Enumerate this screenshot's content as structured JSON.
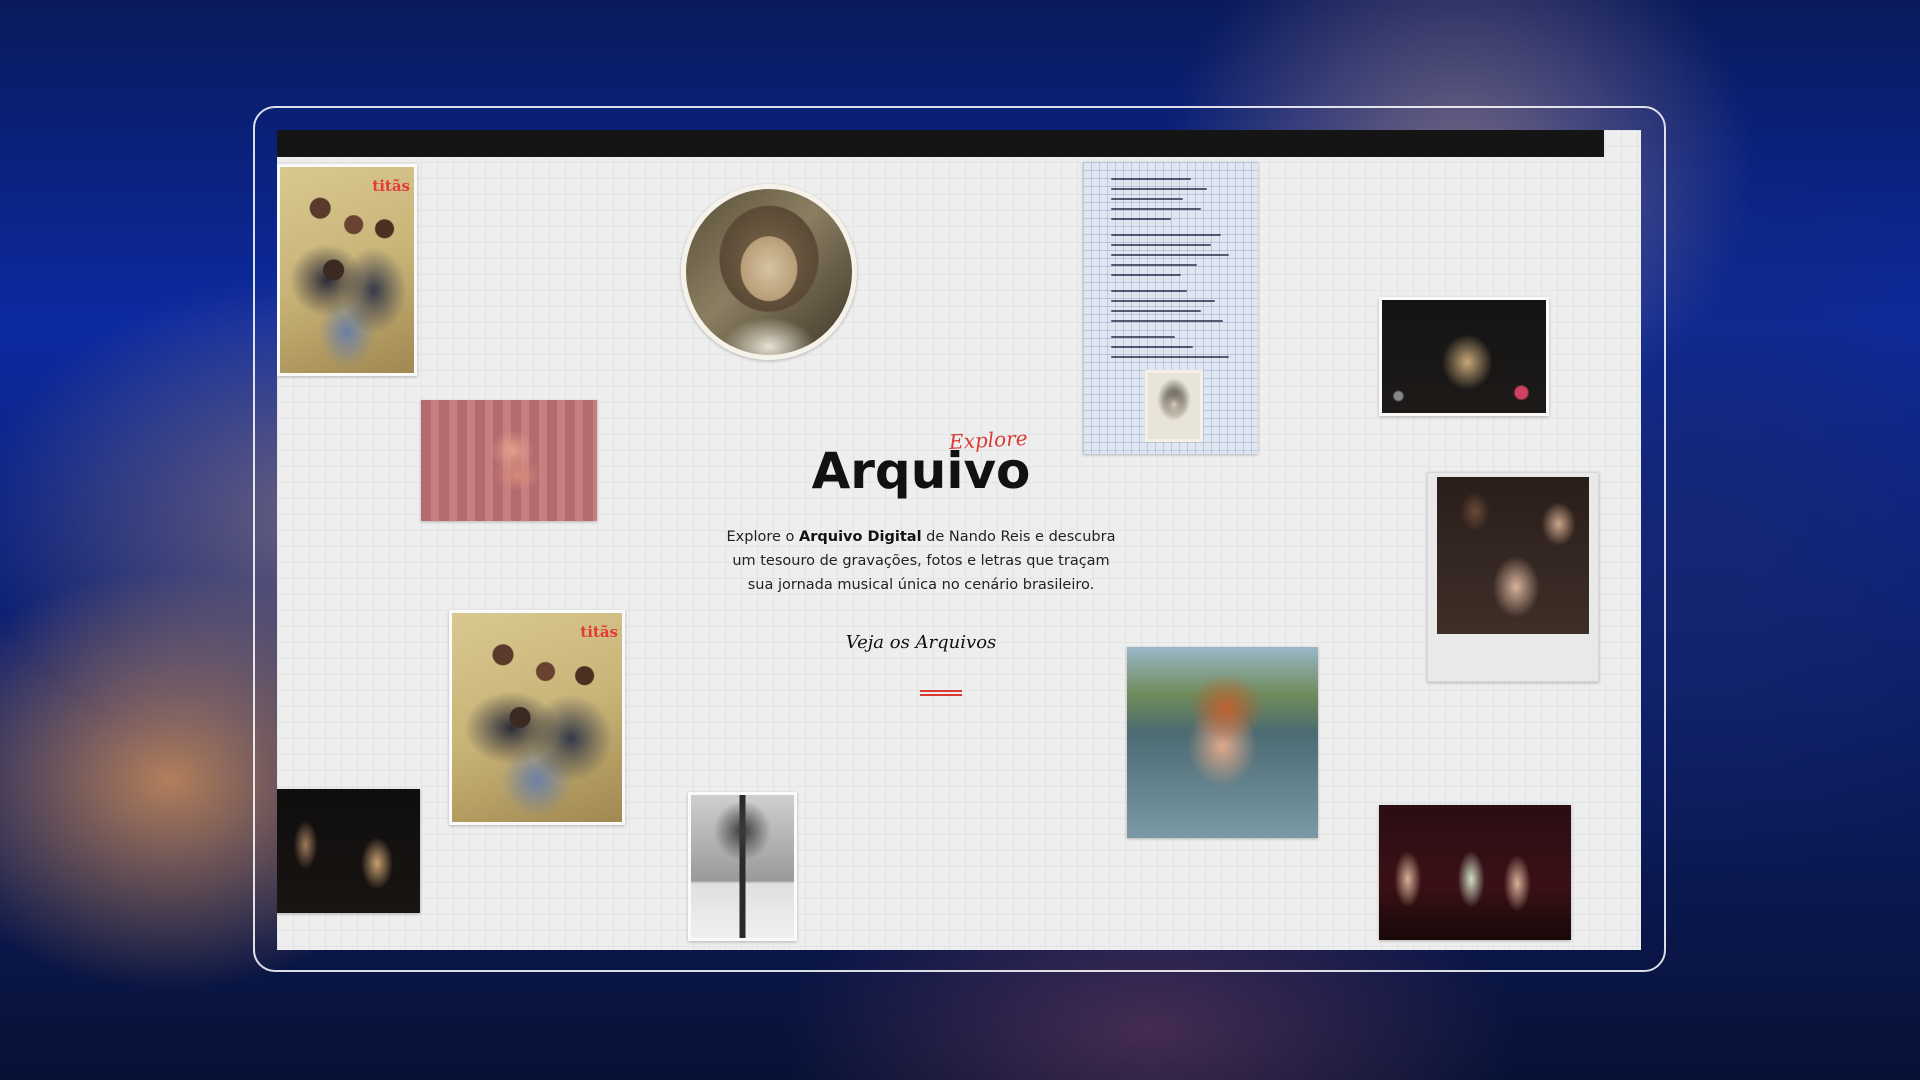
{
  "hero": {
    "eyebrow": "Explore",
    "title": "Arquivo",
    "description_prefix": "Explore o ",
    "description_bold": "Arquivo Digital",
    "description_suffix": " de Nando Reis e descubra um tesouro de gravações, fotos e letras que traçam sua jornada musical única no cenário brasileiro.",
    "cta_label": "Veja os Arquivos"
  },
  "magazine": {
    "logo": "titãs"
  },
  "colors": {
    "accent": "#d83a32",
    "text": "#111111",
    "background": "#eeeeee",
    "topbar": "#151515"
  }
}
